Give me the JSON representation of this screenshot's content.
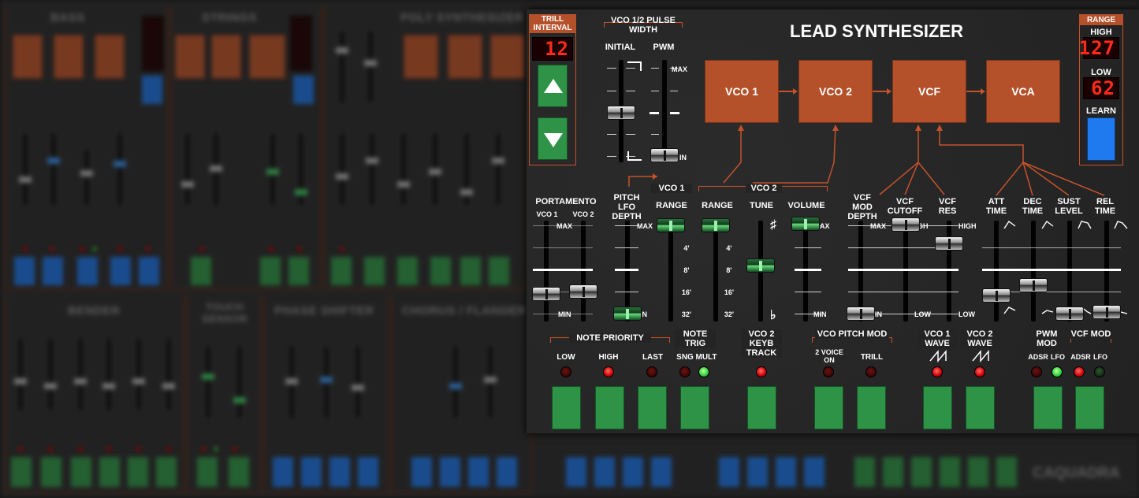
{
  "title": "LEAD SYNTHESIZER",
  "trill": {
    "label": "TRILL INTERVAL",
    "value": "12"
  },
  "range": {
    "label": "RANGE",
    "high_label": "HIGH",
    "high_value": "127",
    "low_label": "LOW",
    "low_value": "62",
    "learn_label": "LEARN"
  },
  "pulse_width": {
    "label": "VCO 1/2 PULSE WIDTH",
    "initial": "INITIAL",
    "pwm": "PWM",
    "max": "MAX",
    "in": "IN"
  },
  "signal_chain": [
    "VCO 1",
    "VCO 2",
    "VCF",
    "VCA"
  ],
  "sliders": {
    "portamento": "PORTAMENTO",
    "vco1": "VCO 1",
    "vco2": "VCO 2",
    "pitch_lfo": "PITCH LFO DEPTH",
    "range": "RANGE",
    "tune": "TUNE",
    "volume": "VOLUME",
    "vcf_mod": "VCF MOD DEPTH",
    "vcf_cutoff": "VCF CUTOFF",
    "vcf_res": "VCF RES",
    "att": "ATT TIME",
    "dec": "DEC TIME",
    "sust": "SUST LEVEL",
    "rel": "REL TIME"
  },
  "marks": {
    "max": "MAX",
    "min": "MIN",
    "in": "IN",
    "ax": "AX",
    "gh": "GH",
    "high": "HIGH",
    "low": "LOW",
    "f4": "4'",
    "f8": "8'",
    "f16": "16'",
    "f32": "32'",
    "sharp": "♯",
    "flat": "♭"
  },
  "groups": {
    "note_priority": "NOTE PRIORITY",
    "low": "LOW",
    "high": "HIGH",
    "last": "LAST",
    "note_trig": "NOTE TRIG",
    "sng": "SNG",
    "mult": "MULT",
    "vco2_keyb": "VCO 2 KEYB TRACK",
    "vco_pitch_mod": "VCO PITCH MOD",
    "two_voice": "2 VOICE ON",
    "trill": "TRILL",
    "vco1_wave": "VCO 1 WAVE",
    "vco2_wave": "VCO 2 WAVE",
    "pwm_mod": "PWM MOD",
    "vcf_mod": "VCF MOD",
    "adsr": "ADSR",
    "lfo": "LFO"
  },
  "background": {
    "bass": "BASS",
    "strings": "STRINGS",
    "poly": "POLY SYNTHESIZER",
    "bender": "BENDER",
    "touch": "TOUCH SENSOR",
    "phase": "PHASE SHIFTER",
    "chorus": "CHORUS / FLANGER",
    "logo": "CAQUADRA"
  },
  "colors": {
    "panel": "#252525",
    "orange": "#b5512a",
    "green": "#2e9347",
    "blue": "#1f6fd8",
    "led_red": "#d10000"
  }
}
